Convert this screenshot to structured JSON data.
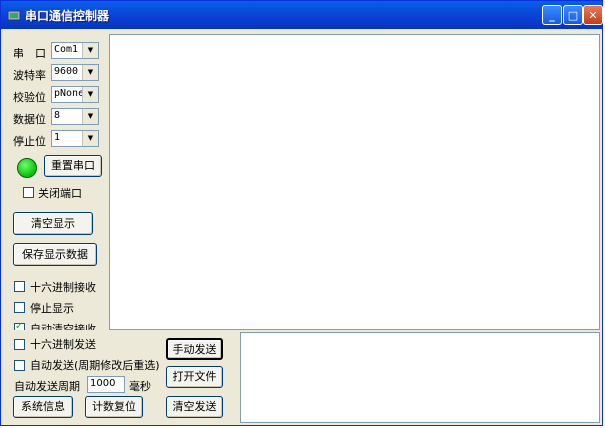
{
  "window": {
    "title": "串口通信控制器",
    "minimize": "_",
    "maximize": "□",
    "close": "✕"
  },
  "serial": {
    "port_label": "串　口",
    "port_value": "Com1",
    "baud_label": "波特率",
    "baud_value": "9600",
    "parity_label": "校验位",
    "parity_value": "pNone",
    "databits_label": "数据位",
    "databits_value": "8",
    "stopbits_label": "停止位",
    "stopbits_value": "1",
    "dropdown_arrow": "▼"
  },
  "controls": {
    "reset_port": "重置串口",
    "close_port": "关闭端口",
    "clear_display": "清空显示",
    "save_display": "保存显示数据",
    "hex_receive": "十六进制接收",
    "stop_display": "停止显示",
    "auto_clear": "自动清空接收",
    "hex_send": "十六进制发送",
    "auto_send": "自动发送(周期修改后重选)",
    "period_label": "自动发送周期",
    "period_value": "1000",
    "period_unit": "毫秒",
    "manual_send": "手动发送",
    "open_file": "打开文件",
    "system_info": "系统信息",
    "count_reset": "计数复位",
    "clear_send": "清空发送"
  },
  "state": {
    "port_led_color": "#06c006",
    "auto_clear_checked": true
  }
}
